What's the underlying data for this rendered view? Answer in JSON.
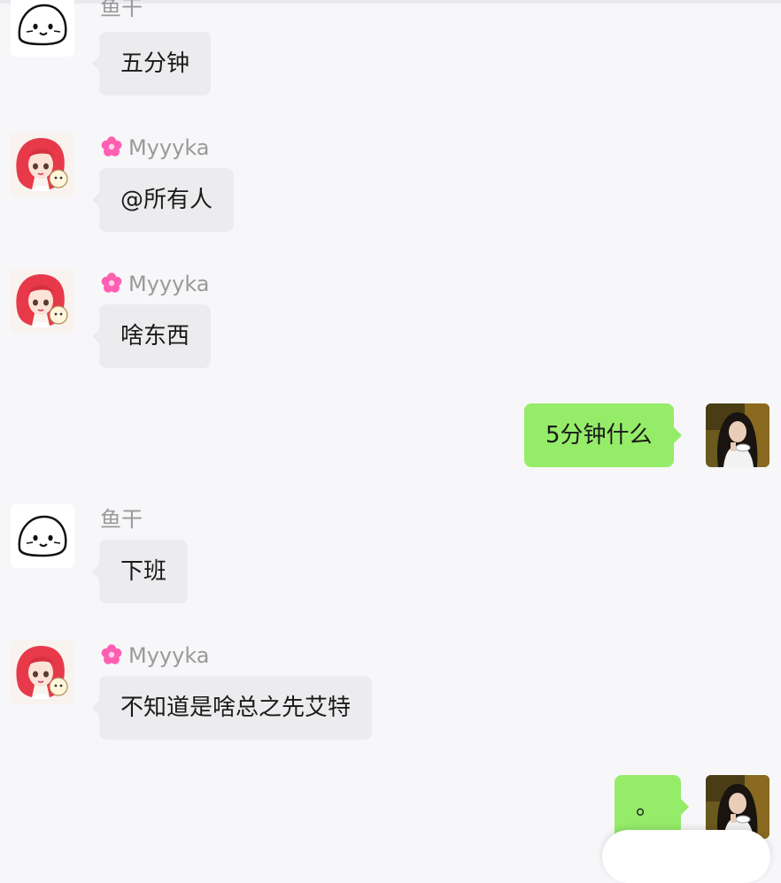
{
  "conversation": {
    "messages": [
      {
        "side": "left",
        "avatar": "seal-avatar",
        "sender": "鱼干",
        "text": "五分钟"
      },
      {
        "side": "left",
        "avatar": "anime-girl-avatar",
        "sender": "Myyyka",
        "sender_icon": "flower-icon",
        "text": "@所有人"
      },
      {
        "side": "left",
        "avatar": "anime-girl-avatar",
        "sender": "Myyyka",
        "sender_icon": "flower-icon",
        "text": "啥东西"
      },
      {
        "side": "right",
        "avatar": "photo-girl-avatar",
        "text": "5分钟什么"
      },
      {
        "side": "left",
        "avatar": "seal-avatar",
        "sender": "鱼干",
        "text": "下班"
      },
      {
        "side": "left",
        "avatar": "anime-girl-avatar",
        "sender": "Myyyka",
        "sender_icon": "flower-icon",
        "text": "不知道是啥总之先艾特"
      },
      {
        "side": "right",
        "avatar": "photo-girl-avatar",
        "text": "。"
      }
    ]
  },
  "colors": {
    "background": "#f7f7f9",
    "incoming_bubble": "#ececee",
    "outgoing_bubble": "#95ec69",
    "sender_name": "#9a9a9a",
    "flower_icon": "#ff5fb1"
  }
}
